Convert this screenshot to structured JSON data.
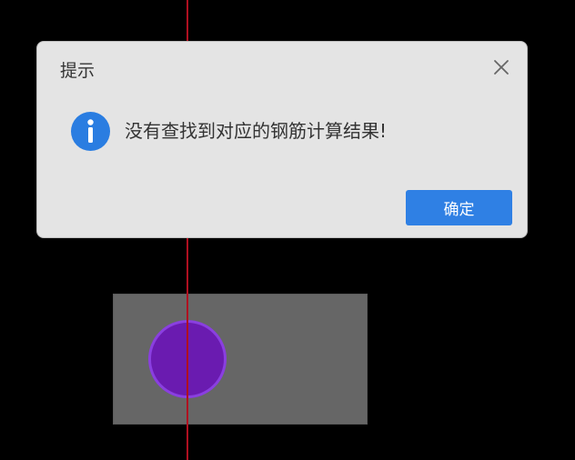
{
  "dialog": {
    "title": "提示",
    "message": "没有查找到对应的钢筋计算结果!",
    "ok_label": "确定",
    "close_icon": "close-icon",
    "info_icon": "info-icon"
  },
  "colors": {
    "background": "#000000",
    "axis_line": "#b01020",
    "section_fill": "#666666",
    "rebar_fill": "#6a1bb0",
    "rebar_stroke": "#8a3fe0",
    "dialog_bg": "#e4e4e4",
    "accent": "#2f80e4"
  }
}
